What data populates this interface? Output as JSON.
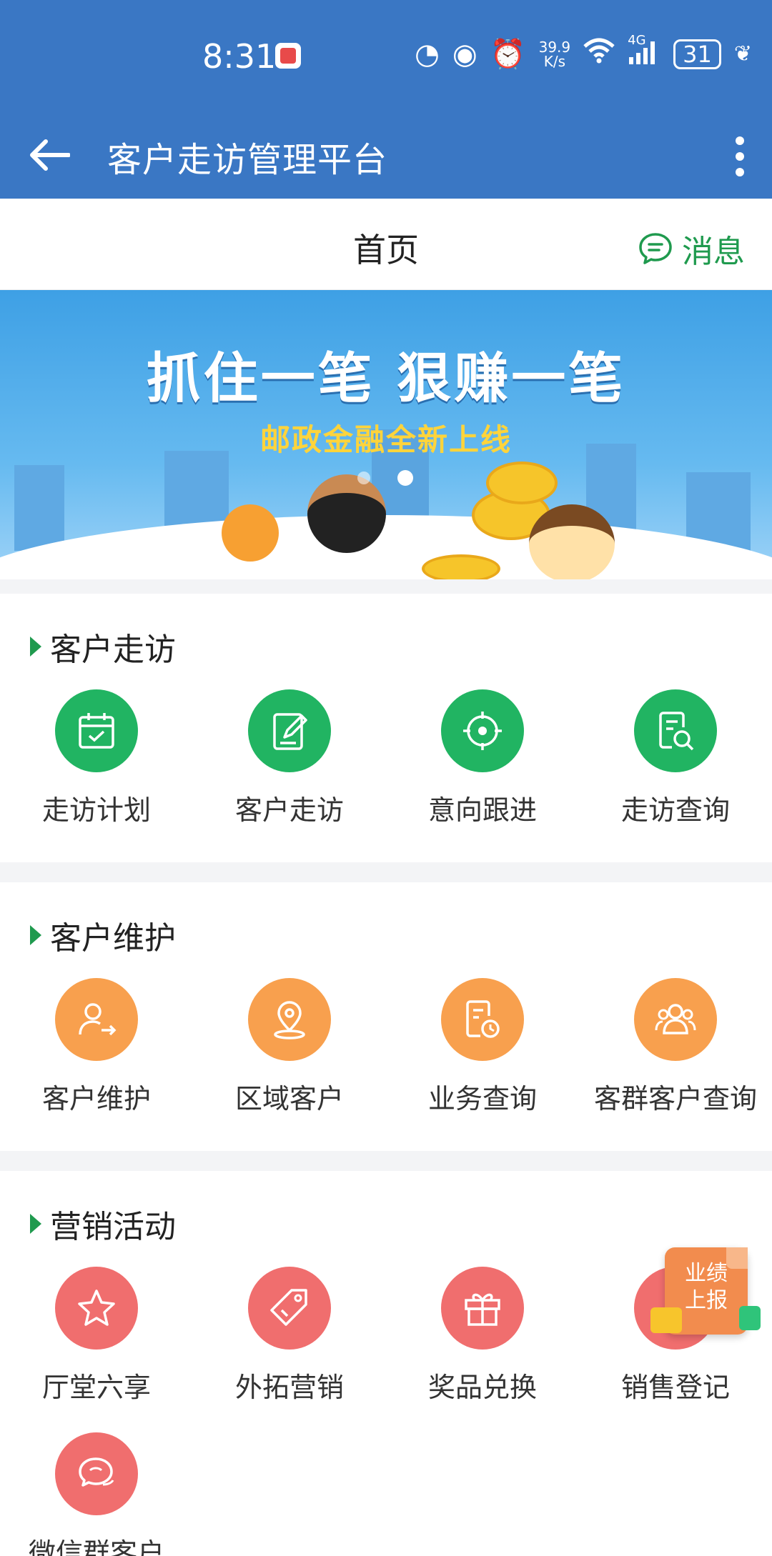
{
  "status_bar": {
    "time": "8:31",
    "net_speed": "39.9",
    "net_unit": "K/s",
    "network": "4G",
    "battery": "31"
  },
  "app_bar": {
    "title": "客户走访管理平台"
  },
  "page": {
    "title": "首页",
    "messages_label": "消息"
  },
  "banner": {
    "headline": "抓住一笔 狠赚一笔",
    "subtitle": "邮政金融全新上线"
  },
  "sections": [
    {
      "title": "客户走访",
      "color": "#21b462",
      "items": [
        {
          "label": "走访计划",
          "icon": "calendar-check-icon"
        },
        {
          "label": "客户走访",
          "icon": "edit-note-icon"
        },
        {
          "label": "意向跟进",
          "icon": "target-icon"
        },
        {
          "label": "走访查询",
          "icon": "document-search-icon"
        }
      ]
    },
    {
      "title": "客户维护",
      "color": "#f8a04e",
      "items": [
        {
          "label": "客户维护",
          "icon": "user-transfer-icon"
        },
        {
          "label": "区域客户",
          "icon": "location-pin-icon"
        },
        {
          "label": "业务查询",
          "icon": "document-clock-icon"
        },
        {
          "label": "客群客户查询",
          "icon": "group-icon"
        }
      ]
    },
    {
      "title": "营销活动",
      "color": "#f06e6e",
      "items": [
        {
          "label": "厅堂六享",
          "icon": "star-icon"
        },
        {
          "label": "外拓营销",
          "icon": "tag-icon"
        },
        {
          "label": "奖品兑换",
          "icon": "gift-icon"
        },
        {
          "label": "销售登记",
          "icon": "user-icon"
        },
        {
          "label": "微信群客户",
          "icon": "chat-bubbles-icon"
        }
      ]
    }
  ],
  "floating_button": {
    "line1": "业绩",
    "line2": "上报"
  }
}
